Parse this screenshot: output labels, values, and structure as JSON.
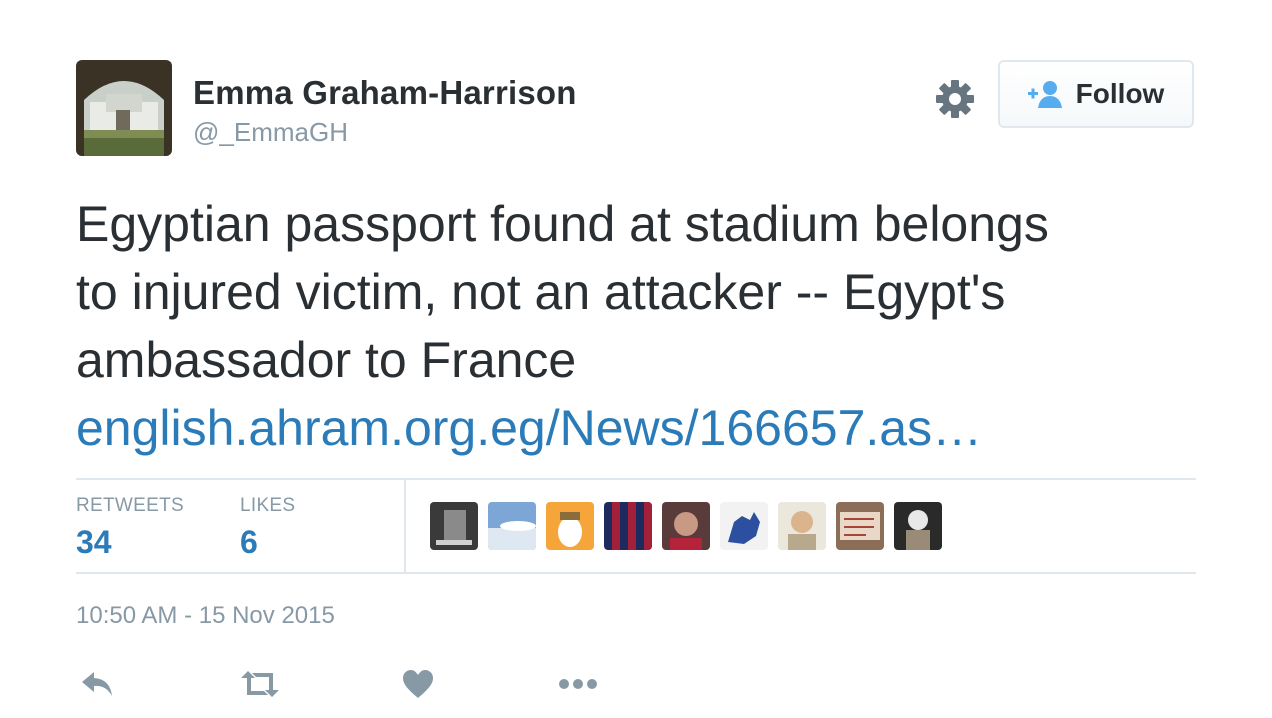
{
  "user": {
    "name": "Emma Graham-Harrison",
    "handle": "@_EmmaGH"
  },
  "follow_button": {
    "label": "Follow",
    "icon": "add-user-icon"
  },
  "settings_icon": "gear-icon",
  "tweet": {
    "text_lines": [
      "Egyptian passport found at stadium belongs",
      "to injured victim, not an attacker -- Egypt's",
      "ambassador to France"
    ],
    "link": "english.ahram.org.eg/News/166657.as…"
  },
  "stats": {
    "retweets_label": "RETWEETS",
    "retweets_value": "34",
    "likes_label": "LIKES",
    "likes_value": "6"
  },
  "timestamp": "10:50 AM - 15 Nov 2015",
  "actions": [
    "reply-icon",
    "retweet-icon",
    "like-icon",
    "more-icon"
  ],
  "colors": {
    "text": "#292f33",
    "muted": "#8899a6",
    "link": "#2b7bb9",
    "border": "#e1e8ed",
    "follow_icon": "#55acee"
  }
}
